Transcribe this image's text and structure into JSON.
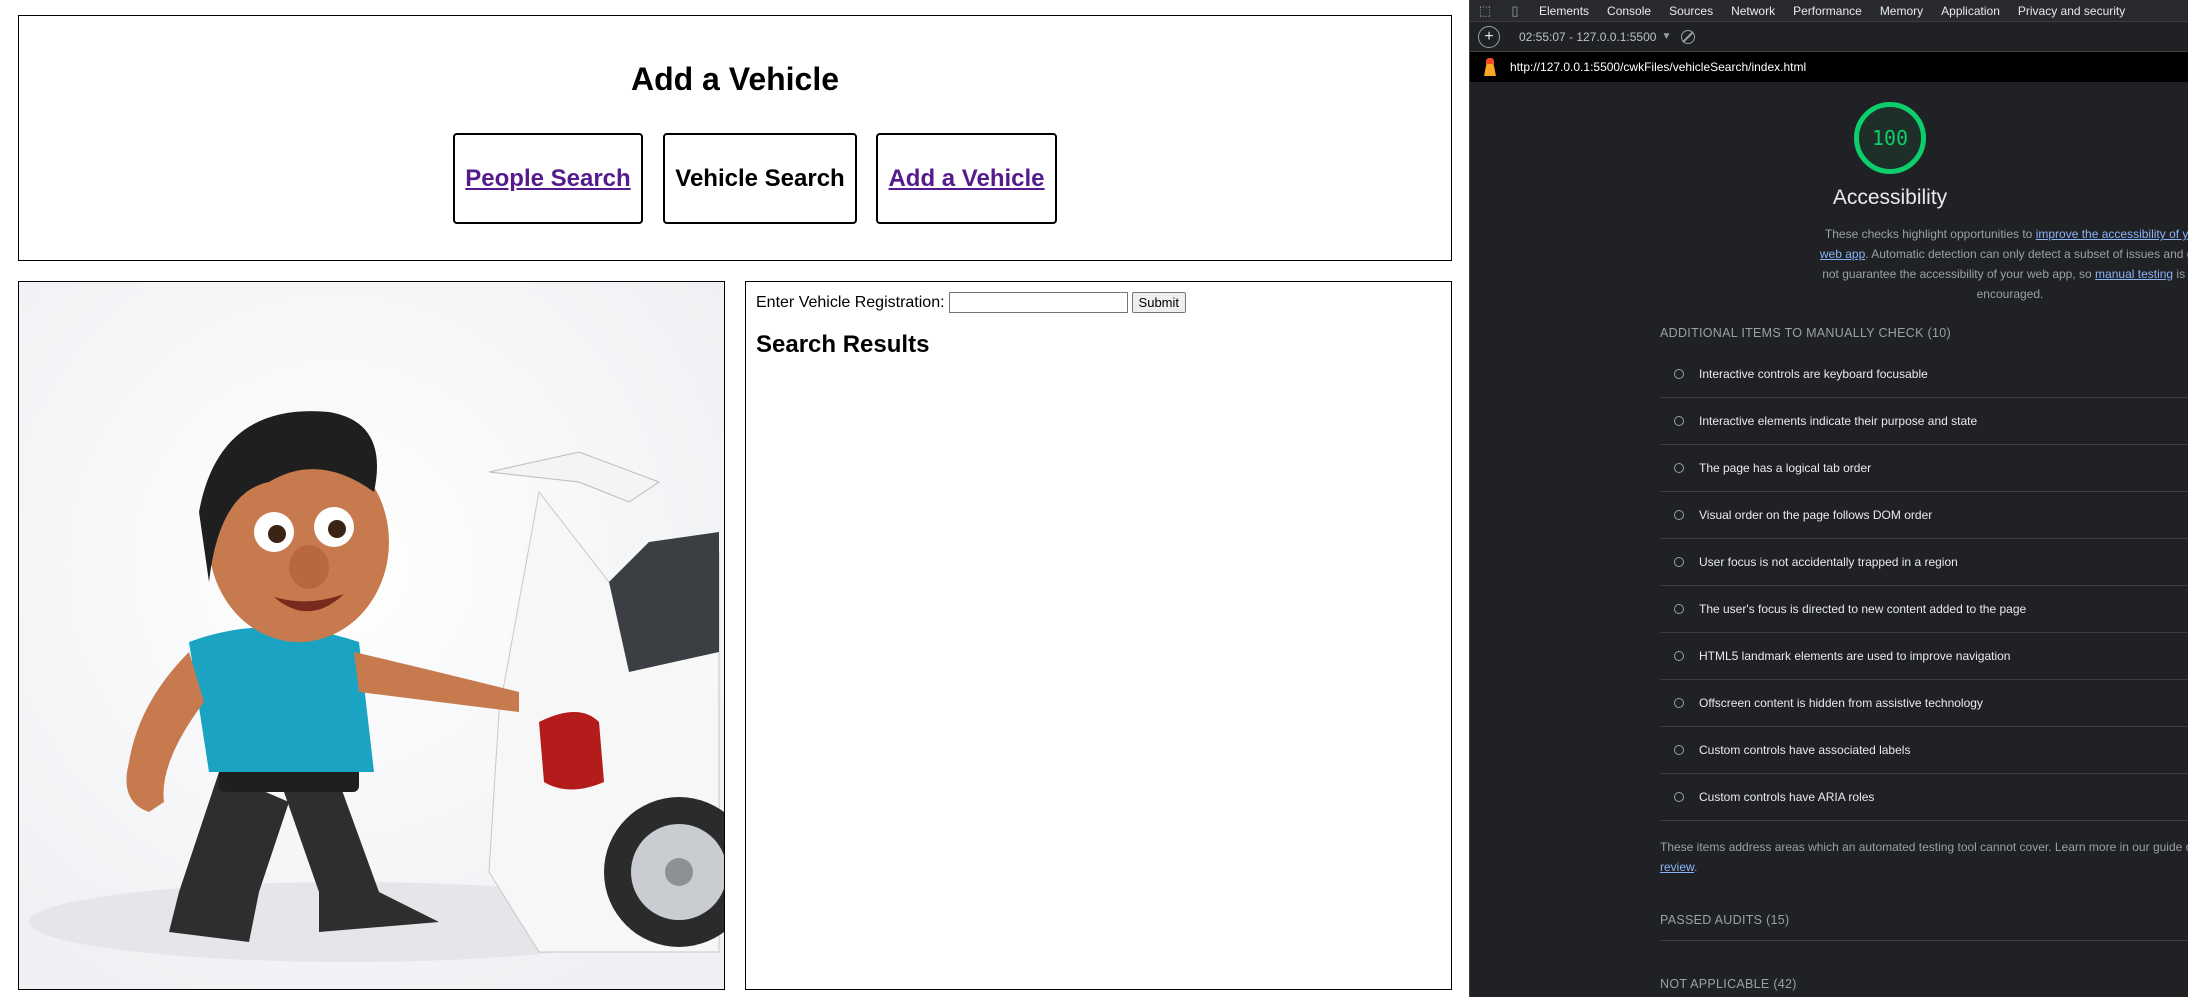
{
  "page": {
    "title": "Add a Vehicle",
    "nav": {
      "people_search": "People Search",
      "vehicle_search": "Vehicle Search",
      "add_vehicle": "Add a Vehicle"
    },
    "form": {
      "reg_label": "Enter Vehicle Registration:",
      "reg_value": "",
      "submit_label": "Submit"
    },
    "results_heading": "Search Results"
  },
  "devtools": {
    "tabs": [
      "Elements",
      "Console",
      "Sources",
      "Network",
      "Performance",
      "Memory",
      "Application",
      "Privacy and security"
    ],
    "report_time": "02:55:07 - 127.0.0.1:5500",
    "url": "http://127.0.0.1:5500/cwkFiles/vehicleSearch/index.html",
    "score": "100",
    "score_color": "#0cce6b",
    "category_title": "Accessibility",
    "desc": {
      "part1": "These checks highlight opportunities to ",
      "link1": "improve the accessibility of yo",
      "link1b": "web app",
      "part2": ". Automatic detection can only detect a subset of issues and do",
      "part3": "not guarantee the accessibility of your web app, so ",
      "link2": "manual testing",
      "part4": " is al",
      "part5": "encouraged."
    },
    "manual_heading": "ADDITIONAL ITEMS TO MANUALLY CHECK (10)",
    "manual_items": [
      "Interactive controls are keyboard focusable",
      "Interactive elements indicate their purpose and state",
      "The page has a logical tab order",
      "Visual order on the page follows DOM order",
      "User focus is not accidentally trapped in a region",
      "The user's focus is directed to new content added to the page",
      "HTML5 landmark elements are used to improve navigation",
      "Offscreen content is hidden from assistive technology",
      "Custom controls have associated labels",
      "Custom controls have ARIA roles"
    ],
    "manual_note": {
      "text": "These items address areas which an automated testing tool cannot cover. Learn more in our guide o",
      "link": "review",
      "end": "."
    },
    "passed_heading": "PASSED AUDITS (15)",
    "na_heading": "NOT APPLICABLE (42)"
  }
}
